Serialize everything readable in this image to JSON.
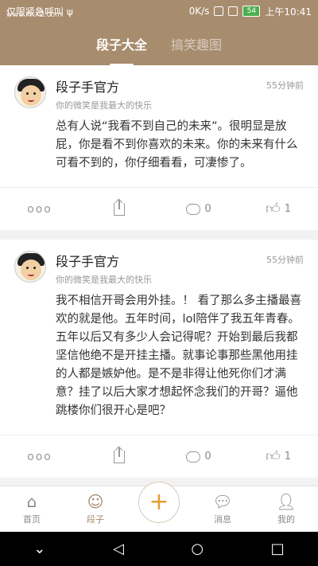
{
  "status_bar": {
    "left_text": "仅限紧急呼叫 ψ",
    "watermark": "www.FXXZ.com",
    "speed": "0K/s",
    "battery": "54",
    "time": "上午10:41"
  },
  "header": {
    "tabs": [
      {
        "label": "段子大全",
        "active": true
      },
      {
        "label": "搞笑趣图",
        "active": false
      }
    ]
  },
  "posts": [
    {
      "user_name": "段子手官方",
      "user_sign": "你的微笑是我最大的快乐",
      "time_ago": "55分钟前",
      "content": "总有人说“我看不到自己的未来”。很明显是放屁，你是看不到你喜欢的未来。你的未来有什么可看不到的，你仔细看看，可凄惨了。",
      "more": "ooo",
      "comments": "0",
      "likes": "1"
    },
    {
      "user_name": "段子手官方",
      "user_sign": "你的微笑是我最大的快乐",
      "time_ago": "55分钟前",
      "content": "我不相信开哥会用外挂。！ 看了那么多主播最喜欢的就是他。五年时间，lol陪伴了我五年青春。五年以后又有多少人会记得呢？开始到最后我都坚信他绝不是开挂主播。就事论事那些黑他用挂的人都是嫉妒他。是不是非得让他死你们才满意？挂了以后大家才想起怀念我们的开哥？逼他跳楼你们很开心是吧？",
      "more": "ooo",
      "comments": "0",
      "likes": "1"
    }
  ],
  "bottom_nav": {
    "items": [
      {
        "label": "首页",
        "icon": "home-icon"
      },
      {
        "label": "段子",
        "icon": "smile-icon"
      },
      {
        "label": "",
        "icon": "plus-icon"
      },
      {
        "label": "消息",
        "icon": "message-icon"
      },
      {
        "label": "我的",
        "icon": "profile-icon"
      }
    ],
    "active_color": "#a88c6e",
    "fab_color": "#e0a030"
  },
  "system_nav": {
    "icons": [
      "down-chevron-icon",
      "back-icon",
      "home-circle-icon",
      "recents-icon"
    ]
  },
  "theme": {
    "header_bg": "#a88c6e"
  }
}
